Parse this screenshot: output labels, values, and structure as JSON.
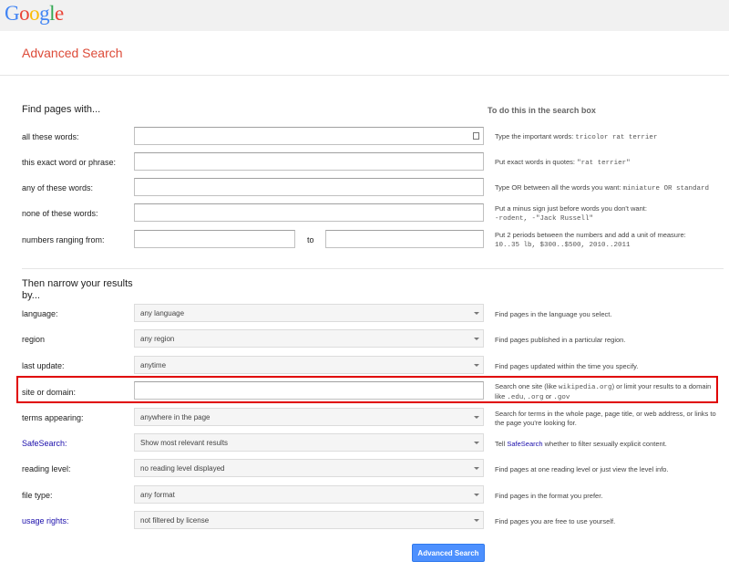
{
  "header": {
    "logo_letters": [
      {
        "ch": "G",
        "color": "#4285f4"
      },
      {
        "ch": "o",
        "color": "#ea4335"
      },
      {
        "ch": "o",
        "color": "#fbbc05"
      },
      {
        "ch": "g",
        "color": "#4285f4"
      },
      {
        "ch": "l",
        "color": "#34a853"
      },
      {
        "ch": "e",
        "color": "#ea4335"
      }
    ],
    "page_title": "Advanced Search"
  },
  "find_section": {
    "heading": "Find pages with...",
    "column_heading": "To do this in the search box",
    "all_words": {
      "label": "all these words:",
      "value": "",
      "hint_text": "Type the important words: ",
      "hint_code": "tricolor rat terrier"
    },
    "exact_phrase": {
      "label": "this exact word or phrase:",
      "value": "",
      "hint_text": "Put exact words in quotes: ",
      "hint_code": "\"rat terrier\""
    },
    "any_words": {
      "label": "any of these words:",
      "value": "",
      "hint_text": "Type OR between all the words you want: ",
      "hint_code": "miniature OR standard"
    },
    "none_words": {
      "label": "none of these words:",
      "value": "",
      "hint_text": "Put a minus sign just before words you don't want:",
      "hint_code": "-rodent, -\"Jack Russell\""
    },
    "numbers_range": {
      "label": "numbers ranging from:",
      "from_value": "",
      "to_label": "to",
      "to_value": "",
      "hint_text": "Put 2 periods between the numbers and add a unit of measure:",
      "hint_code": "10..35 lb, $300..$500, 2010..2011"
    }
  },
  "narrow_section": {
    "heading": "Then narrow your results by...",
    "language": {
      "label": "language:",
      "selected": "any language",
      "hint": "Find pages in the language you select."
    },
    "region": {
      "label": "region",
      "selected": "any region",
      "hint": "Find pages published in a particular region."
    },
    "last_update": {
      "label": "last update:",
      "selected": "anytime",
      "hint": "Find pages updated within the time you specify."
    },
    "site_domain": {
      "label": "site or domain:",
      "value": "",
      "hint_text_1": "Search one site (like ",
      "hint_code_1": "wikipedia.org",
      "hint_text_2": ") or limit your results to a domain like ",
      "hint_code_2": ".edu",
      "hint_text_3": ", ",
      "hint_code_3": ".org",
      "hint_text_4": " or ",
      "hint_code_4": ".gov"
    },
    "terms_appearing": {
      "label": "terms appearing:",
      "selected": "anywhere in the page",
      "hint": "Search for terms in the whole page, page title, or web address, or links to the page you're looking for."
    },
    "safesearch": {
      "label": "SafeSearch:",
      "selected": "Show most relevant results",
      "hint_prefix": "Tell ",
      "hint_link": "SafeSearch",
      "hint_suffix": " whether to filter sexually explicit content."
    },
    "reading_level": {
      "label": "reading level:",
      "selected": "no reading level displayed",
      "hint": "Find pages at one reading level or just view the level info."
    },
    "file_type": {
      "label": "file type:",
      "selected": "any format",
      "hint": "Find pages in the format you prefer."
    },
    "usage_rights": {
      "label": "usage rights:",
      "selected": "not filtered by license",
      "hint": "Find pages you are free to use yourself."
    }
  },
  "submit_label": "Advanced Search",
  "colors": {
    "accent_red": "#dd4b39",
    "link_blue": "#1a0dab",
    "button_blue": "#4d90fe",
    "highlight_red": "#e00000"
  }
}
